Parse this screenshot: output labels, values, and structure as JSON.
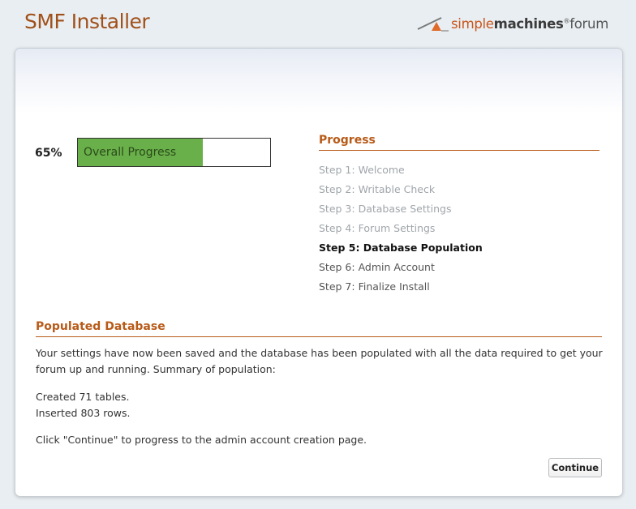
{
  "header": {
    "app_title": "SMF Installer",
    "logo": {
      "simple": "simple",
      "machines": "machines",
      "reg": "®",
      "forum": "forum"
    }
  },
  "progress": {
    "percent_label": "65%",
    "percent": 65,
    "bar_label": "Overall Progress",
    "heading": "Progress",
    "steps": [
      {
        "label": "Step 1: Welcome",
        "state": "done"
      },
      {
        "label": "Step 2: Writable Check",
        "state": "done"
      },
      {
        "label": "Step 3: Database Settings",
        "state": "done"
      },
      {
        "label": "Step 4: Forum Settings",
        "state": "done"
      },
      {
        "label": "Step 5: Database Population",
        "state": "current"
      },
      {
        "label": "Step 6: Admin Account",
        "state": "todo"
      },
      {
        "label": "Step 7: Finalize Install",
        "state": "todo"
      }
    ]
  },
  "content": {
    "heading": "Populated Database",
    "intro": "Your settings have now been saved and the database has been populated with all the data required to get your forum up and running. Summary of population:",
    "summary_line1": "Created 71 tables.",
    "summary_line2": "Inserted 803 rows.",
    "instruction": "Click \"Continue\" to progress to the admin account creation page.",
    "continue_label": "Continue"
  },
  "colors": {
    "accent": "#b85a18",
    "bar_fill": "#6ab04a",
    "title": "#a0501a"
  }
}
